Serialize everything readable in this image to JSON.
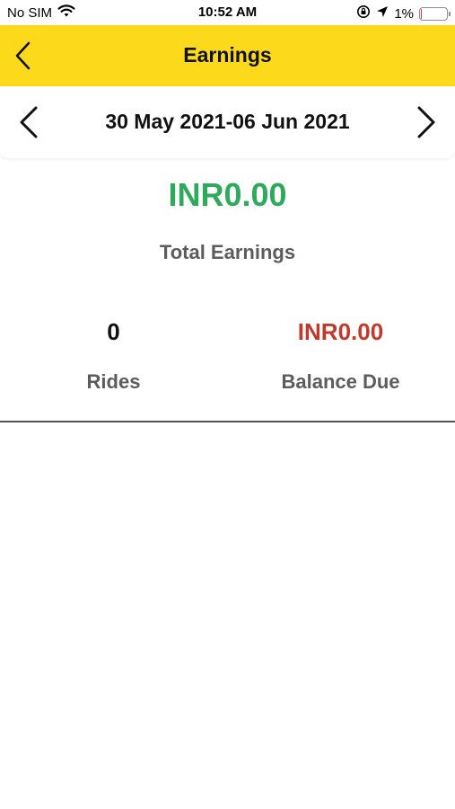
{
  "status_bar": {
    "carrier": "No SIM",
    "time": "10:52 AM",
    "battery_percent": "1%",
    "battery_level": 0.01,
    "icons": [
      "wifi-icon",
      "rotation-lock-icon",
      "location-arrow-icon",
      "battery-icon"
    ]
  },
  "nav": {
    "title": "Earnings",
    "back_icon": "chevron-left-icon"
  },
  "date_selector": {
    "range": "30 May 2021-06 Jun 2021",
    "prev_icon": "chevron-left-icon",
    "next_icon": "chevron-right-icon"
  },
  "summary": {
    "total_amount": "INR0.00",
    "total_label": "Total Earnings",
    "rides_value": "0",
    "rides_label": "Rides",
    "balance_value": "INR0.00",
    "balance_label": "Balance Due"
  },
  "colors": {
    "header_yellow": "#fcd91a",
    "total_green": "#2eaa5c",
    "balance_red": "#c0392b",
    "label_gray": "#5c5c5c"
  }
}
